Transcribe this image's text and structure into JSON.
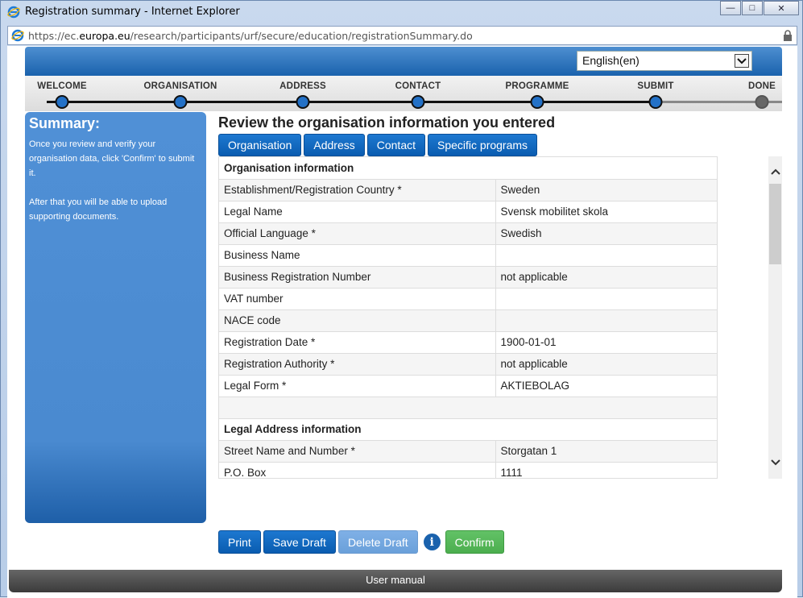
{
  "window": {
    "title": "Registration summary - Internet Explorer",
    "url_prefix": "https://ec.",
    "url_domain": "europa.eu",
    "url_path": "/research/participants/urf/secure/education/registrationSummary.do"
  },
  "language": {
    "selected": "English(en)"
  },
  "steps": [
    {
      "label": "WELCOME"
    },
    {
      "label": "ORGANISATION"
    },
    {
      "label": "ADDRESS"
    },
    {
      "label": "CONTACT"
    },
    {
      "label": "PROGRAMME"
    },
    {
      "label": "SUBMIT"
    },
    {
      "label": "DONE"
    }
  ],
  "sidebar": {
    "title": "Summary:",
    "text1": "Once you review and verify your organisation data, click 'Confirm' to submit it.",
    "text2": "After that you will be able to upload supporting documents."
  },
  "main": {
    "title": "Review the organisation information you entered",
    "tabs": [
      "Organisation",
      "Address",
      "Contact",
      "Specific programs"
    ]
  },
  "table": {
    "section1": "Organisation information",
    "rows1": [
      {
        "k": "Establishment/Registration Country *",
        "v": "Sweden"
      },
      {
        "k": "Legal Name",
        "v": "Svensk mobilitet skola"
      },
      {
        "k": "Official Language *",
        "v": "Swedish"
      },
      {
        "k": "Business Name",
        "v": ""
      },
      {
        "k": "Business Registration Number",
        "v": "not applicable"
      },
      {
        "k": "VAT number",
        "v": ""
      },
      {
        "k": "NACE code",
        "v": ""
      },
      {
        "k": "Registration Date *",
        "v": "1900-01-01"
      },
      {
        "k": "Registration Authority *",
        "v": "not applicable"
      },
      {
        "k": "Legal Form *",
        "v": "AKTIEBOLAG"
      }
    ],
    "section2": "Legal Address information",
    "rows2": [
      {
        "k": "Street Name and Number *",
        "v": "Storgatan 1"
      },
      {
        "k": "P.O. Box",
        "v": "1111"
      }
    ]
  },
  "actions": {
    "print": "Print",
    "save": "Save Draft",
    "delete": "Delete Draft",
    "info": "i",
    "confirm": "Confirm"
  },
  "footer": {
    "label": "User manual"
  },
  "colors": {
    "accent": "#0a5cb0",
    "confirm": "#4cae4f",
    "footer": "#3b3b3b"
  }
}
